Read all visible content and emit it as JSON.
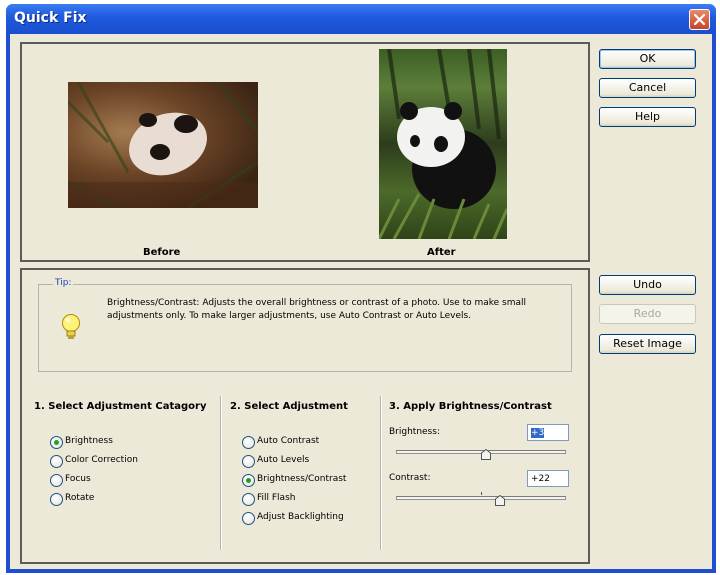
{
  "window": {
    "title": "Quick Fix"
  },
  "preview": {
    "before_label": "Before",
    "after_label": "After"
  },
  "tip": {
    "label": "Tip:",
    "text": "Brightness/Contrast: Adjusts the overall brightness or contrast of a photo. Use to make small adjustments only. To make larger adjustments, use  Auto Contrast or Auto Levels."
  },
  "categories": {
    "heading": "1. Select Adjustment Catagory",
    "items": [
      {
        "label": "Brightness",
        "selected": true
      },
      {
        "label": "Color Correction",
        "selected": false
      },
      {
        "label": "Focus",
        "selected": false
      },
      {
        "label": "Rotate",
        "selected": false
      }
    ]
  },
  "adjustments": {
    "heading": "2. Select Adjustment",
    "items": [
      {
        "label": "Auto Contrast",
        "selected": false
      },
      {
        "label": "Auto Levels",
        "selected": false
      },
      {
        "label": "Brightness/Contrast",
        "selected": true
      },
      {
        "label": "Fill Flash",
        "selected": false
      },
      {
        "label": "Adjust Backlighting",
        "selected": false
      }
    ]
  },
  "apply": {
    "heading": "3. Apply Brightness/Contrast",
    "brightness": {
      "label": "Brightness:",
      "value": "+3",
      "level": 0.53
    },
    "contrast": {
      "label": "Contrast:",
      "value": "+22",
      "level": 0.61
    }
  },
  "buttons": {
    "ok": "OK",
    "cancel": "Cancel",
    "help": "Help",
    "undo": "Undo",
    "redo": "Redo",
    "reset": "Reset Image"
  },
  "icons": {
    "close": "close-icon",
    "tip": "lightbulb-icon",
    "slider_thumb": "slider-thumb-icon"
  },
  "colors": {
    "titlebar": "#1f59dd",
    "dialog_bg": "#ece9d8",
    "tip_label": "#1d3fbb",
    "radio_selected": "#21a121"
  }
}
